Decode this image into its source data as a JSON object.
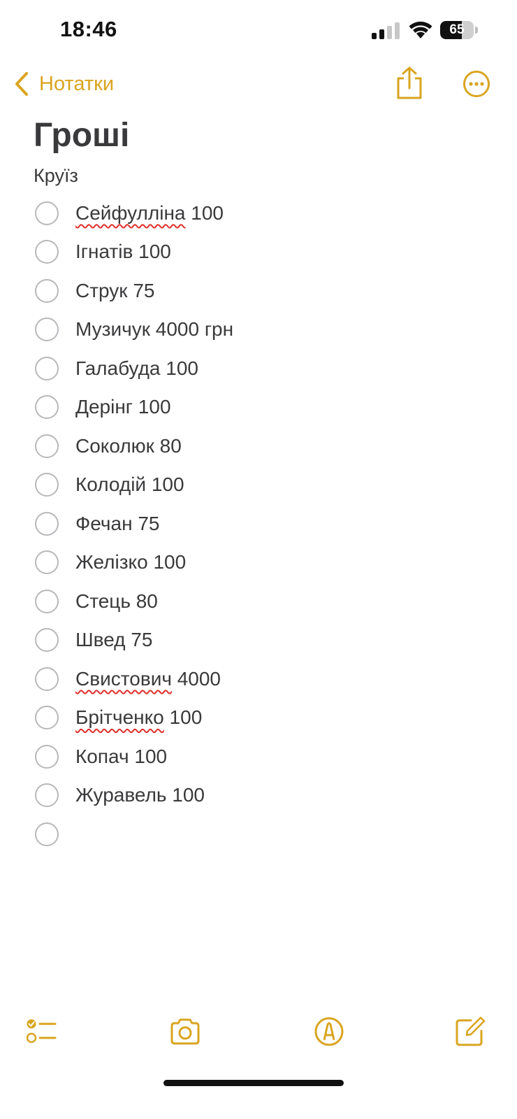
{
  "status_bar": {
    "time": "18:46",
    "battery_level": "65",
    "battery_fraction": 0.65
  },
  "nav": {
    "back_label": "Нотатки",
    "back_icon": "chevron-left-icon",
    "share_icon": "share-icon",
    "more_icon": "ellipsis-circle-icon"
  },
  "note": {
    "title": "Гроші",
    "subtitle": "Круїз",
    "items": [
      {
        "name": "Сейфулліна",
        "amount": " 100",
        "misspelled": true
      },
      {
        "name": "Ігнатів",
        "amount": " 100",
        "misspelled": false
      },
      {
        "name": "Струк",
        "amount": " 75",
        "misspelled": false
      },
      {
        "name": "Музичук",
        "amount": " 4000 грн",
        "misspelled": false
      },
      {
        "name": "Галабуда",
        "amount": " 100",
        "misspelled": false
      },
      {
        "name": "Дерінг",
        "amount": " 100",
        "misspelled": false
      },
      {
        "name": "Соколюк",
        "amount": " 80",
        "misspelled": false
      },
      {
        "name": "Колодій",
        "amount": " 100",
        "misspelled": false
      },
      {
        "name": "Фечан",
        "amount": " 75",
        "misspelled": false
      },
      {
        "name": "Желізко",
        "amount": " 100",
        "misspelled": false
      },
      {
        "name": "Стець",
        "amount": " 80",
        "misspelled": false
      },
      {
        "name": "Швед",
        "amount": " 75",
        "misspelled": false
      },
      {
        "name": "Свистович",
        "amount": " 4000",
        "misspelled": true
      },
      {
        "name": "Брітченко",
        "amount": " 100",
        "misspelled": true
      },
      {
        "name": "Копач",
        "amount": " 100",
        "misspelled": false
      },
      {
        "name": "Журавель",
        "amount": " 100",
        "misspelled": false
      },
      {
        "name": "",
        "amount": "",
        "misspelled": false
      }
    ]
  },
  "toolbar": {
    "checklist_icon": "checklist-icon",
    "camera_icon": "camera-icon",
    "markup_icon": "markup-pen-icon",
    "compose_icon": "compose-icon"
  },
  "colors": {
    "accent": "#d9a520",
    "text": "#3a3a3c",
    "checkbox_border": "#b8b8bc",
    "spellcheck": "#e0302a"
  }
}
